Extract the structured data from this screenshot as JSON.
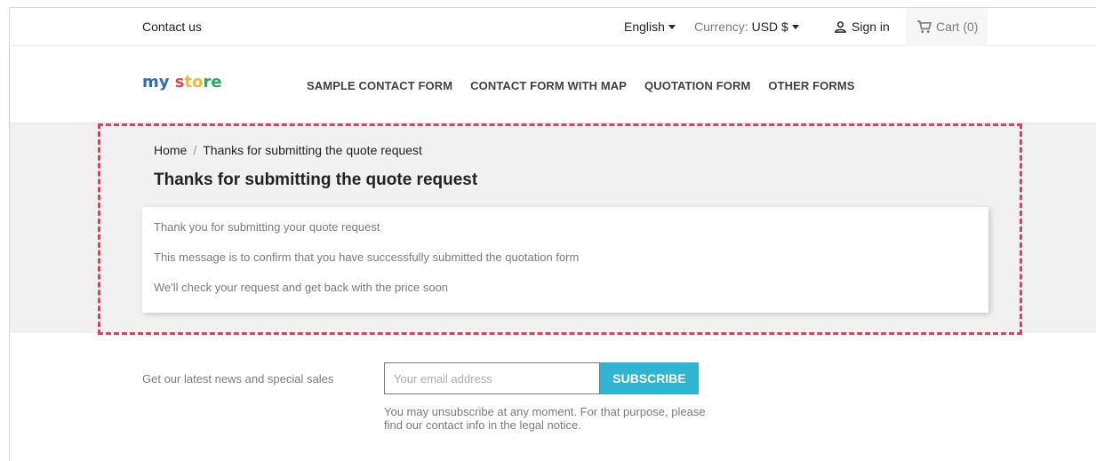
{
  "topnav": {
    "contact_label": "Contact us",
    "language": "English",
    "currency_label": "Currency:",
    "currency_value": "USD $",
    "signin_label": "Sign in",
    "cart_label": "Cart",
    "cart_count": "(0)"
  },
  "header": {
    "logo": {
      "part1": "my",
      "part2": " s",
      "part3": "to",
      "part4": "re"
    },
    "menu": [
      {
        "label": "SAMPLE CONTACT FORM"
      },
      {
        "label": "CONTACT FORM WITH MAP"
      },
      {
        "label": "QUOTATION FORM"
      },
      {
        "label": "OTHER FORMS"
      }
    ]
  },
  "main": {
    "breadcrumb": {
      "home": "Home",
      "separator": "/",
      "current": "Thanks for submitting the quote request"
    },
    "title": "Thanks for submitting the quote request",
    "messages": [
      "Thank you for submitting your quote request",
      "This message is to confirm that you have successfully submitted the quotation form",
      "We'll check your request and get back with the price soon"
    ]
  },
  "newsletter": {
    "label": "Get our latest news and special sales",
    "email_placeholder": "Your email address",
    "subscribe_label": "SUBSCRIBE",
    "unsubscribe_text": "You may unsubscribe at any moment. For that purpose, please find our contact info in the legal notice."
  },
  "colors": {
    "accent": "#2fb5d2",
    "highlight_border": "#e0405e",
    "background_gray": "#f1f1f1"
  },
  "icons": [
    "user-icon",
    "cart-icon",
    "caret-down-icon"
  ]
}
